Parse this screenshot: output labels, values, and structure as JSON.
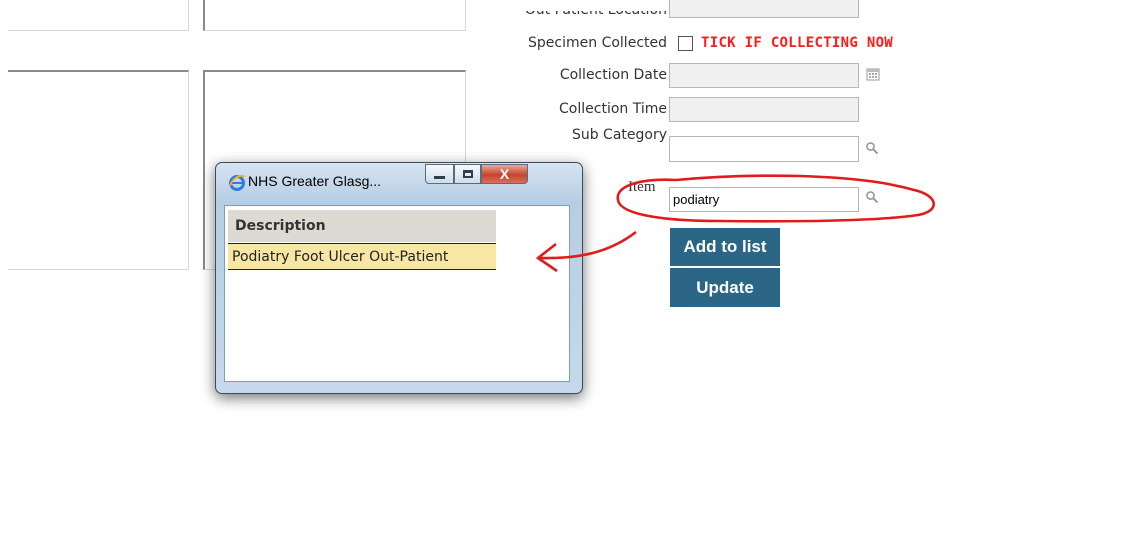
{
  "form": {
    "labels": {
      "out_patient_location": "Out Patient Location",
      "specimen_collected": "Specimen Collected",
      "collection_date": "Collection Date",
      "collection_time": "Collection Time",
      "sub_category": "Sub Category",
      "item": "Item"
    },
    "tick_note": "TICK IF COLLECTING NOW",
    "item_value": "podiatry",
    "sub_category_value": "",
    "collection_date_value": "",
    "collection_time_value": ""
  },
  "buttons": {
    "add_to_list": "Add to list",
    "update": "Update"
  },
  "popup": {
    "title": "NHS Greater Glasg...",
    "close_glyph": "X",
    "grid": {
      "column_header": "Description",
      "rows": [
        "Podiatry Foot Ulcer Out-Patient"
      ]
    }
  },
  "colors": {
    "accent_button": "#2c6686",
    "warning_text": "#ff1a1a",
    "selected_row": "#f8e7a4",
    "annotation": "#e01b1b"
  },
  "icons": {
    "calendar": "calendar-icon",
    "search": "magnifier-icon",
    "browser": "internet-explorer-icon"
  }
}
